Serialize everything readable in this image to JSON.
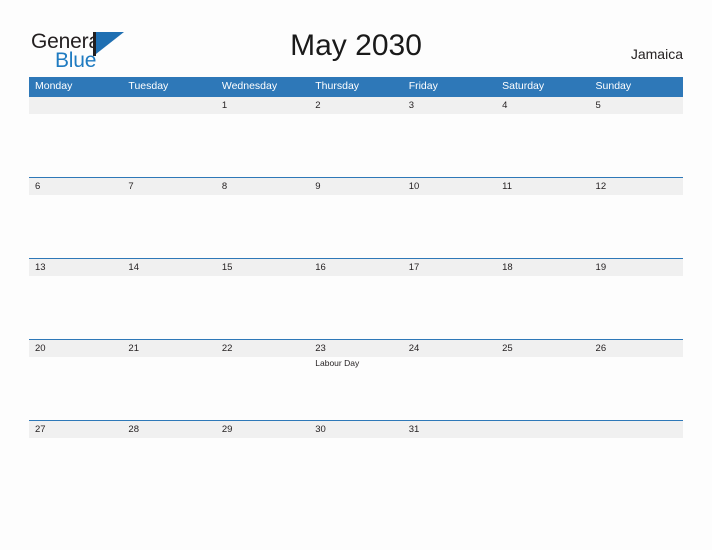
{
  "brand": {
    "name_top": "General",
    "name_bottom": "Blue",
    "logo_icon": "flag-triangle-icon",
    "accent_color": "#1f7bc1",
    "text_color": "#231f20"
  },
  "header": {
    "title": "May 2030",
    "region": "Jamaica"
  },
  "calendar": {
    "header_bg": "#2e78b8",
    "band_bg": "#f0f0f0",
    "rule_color": "#2e78b8",
    "weekdays": [
      "Monday",
      "Tuesday",
      "Wednesday",
      "Thursday",
      "Friday",
      "Saturday",
      "Sunday"
    ],
    "weeks": [
      [
        {
          "day": "",
          "event": ""
        },
        {
          "day": "",
          "event": ""
        },
        {
          "day": "1",
          "event": ""
        },
        {
          "day": "2",
          "event": ""
        },
        {
          "day": "3",
          "event": ""
        },
        {
          "day": "4",
          "event": ""
        },
        {
          "day": "5",
          "event": ""
        }
      ],
      [
        {
          "day": "6",
          "event": ""
        },
        {
          "day": "7",
          "event": ""
        },
        {
          "day": "8",
          "event": ""
        },
        {
          "day": "9",
          "event": ""
        },
        {
          "day": "10",
          "event": ""
        },
        {
          "day": "11",
          "event": ""
        },
        {
          "day": "12",
          "event": ""
        }
      ],
      [
        {
          "day": "13",
          "event": ""
        },
        {
          "day": "14",
          "event": ""
        },
        {
          "day": "15",
          "event": ""
        },
        {
          "day": "16",
          "event": ""
        },
        {
          "day": "17",
          "event": ""
        },
        {
          "day": "18",
          "event": ""
        },
        {
          "day": "19",
          "event": ""
        }
      ],
      [
        {
          "day": "20",
          "event": ""
        },
        {
          "day": "21",
          "event": ""
        },
        {
          "day": "22",
          "event": ""
        },
        {
          "day": "23",
          "event": "Labour Day"
        },
        {
          "day": "24",
          "event": ""
        },
        {
          "day": "25",
          "event": ""
        },
        {
          "day": "26",
          "event": ""
        }
      ],
      [
        {
          "day": "27",
          "event": ""
        },
        {
          "day": "28",
          "event": ""
        },
        {
          "day": "29",
          "event": ""
        },
        {
          "day": "30",
          "event": ""
        },
        {
          "day": "31",
          "event": ""
        },
        {
          "day": "",
          "event": ""
        },
        {
          "day": "",
          "event": ""
        }
      ]
    ]
  }
}
